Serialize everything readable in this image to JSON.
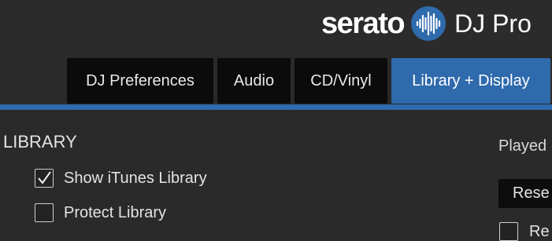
{
  "brand": {
    "word": "serato",
    "logo_icon": "serato-waveform-logo-icon",
    "product": "DJ Pro"
  },
  "tabs": [
    {
      "label": "DJ Preferences",
      "active": false
    },
    {
      "label": "Audio",
      "active": false
    },
    {
      "label": "CD/Vinyl",
      "active": false
    },
    {
      "label": "Library + Display",
      "active": true
    }
  ],
  "library": {
    "title": "LIBRARY",
    "options": [
      {
        "label": "Show iTunes Library",
        "checked": true
      },
      {
        "label": "Protect Library",
        "checked": false
      }
    ]
  },
  "right_panel": {
    "label": "Played",
    "button_label": "Rese",
    "checkbox_label": "Re"
  },
  "colors": {
    "accent": "#2f6aac",
    "background": "#2a2a2a",
    "tab_bg": "#0b0b0b"
  }
}
